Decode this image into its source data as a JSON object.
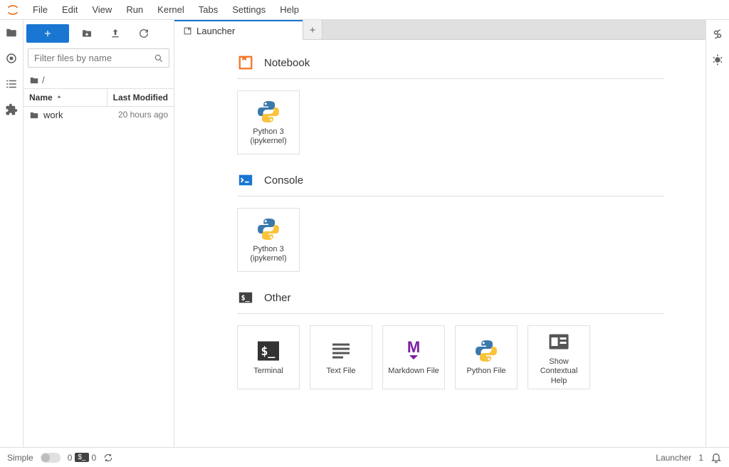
{
  "menu": [
    "File",
    "Edit",
    "View",
    "Run",
    "Kernel",
    "Tabs",
    "Settings",
    "Help"
  ],
  "filebrowser": {
    "filter_placeholder": "Filter files by name",
    "breadcrumb_root": "/",
    "header_name": "Name",
    "header_modified": "Last Modified",
    "rows": [
      {
        "name": "work",
        "modified": "20 hours ago"
      }
    ]
  },
  "tabs": {
    "active": "Launcher"
  },
  "launcher": {
    "sections": {
      "notebook": {
        "title": "Notebook",
        "cards": [
          {
            "label": "Python 3 (ipykernel)"
          }
        ]
      },
      "console": {
        "title": "Console",
        "cards": [
          {
            "label": "Python 3 (ipykernel)"
          }
        ]
      },
      "other": {
        "title": "Other",
        "cards": [
          {
            "label": "Terminal"
          },
          {
            "label": "Text File"
          },
          {
            "label": "Markdown File"
          },
          {
            "label": "Python File"
          },
          {
            "label": "Show Contextual Help"
          }
        ]
      }
    }
  },
  "status": {
    "simple_label": "Simple",
    "running_count": "0",
    "terminal_count": "0",
    "launcher_label": "Launcher",
    "right_count": "1"
  }
}
